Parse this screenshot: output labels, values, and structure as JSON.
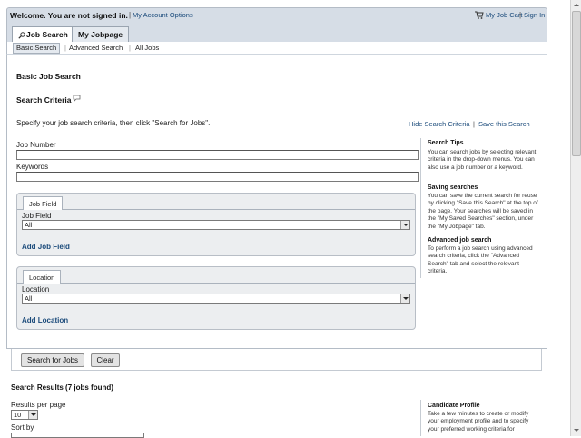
{
  "header": {
    "welcome": "Welcome. You are not signed in.",
    "separator": "|",
    "my_account": "My Account Options",
    "cart": "My Job Cart",
    "sign_in": "Sign In"
  },
  "tabs": {
    "job_search": "Job Search",
    "my_jobpage": "My Jobpage"
  },
  "subtabs": {
    "basic": "Basic Search",
    "advanced": "Advanced Search",
    "all_jobs": "All Jobs",
    "sep": "|"
  },
  "main": {
    "heading": "Basic Job Search",
    "criteria_heading": "Search Criteria",
    "instruction": "Specify your job search criteria, then click \"Search for Jobs\".",
    "hide_criteria": "Hide Search Criteria",
    "link_sep": "|",
    "save_search": "Save this Search",
    "job_number_label": "Job Number",
    "job_number_value": "",
    "keywords_label": "Keywords",
    "keywords_value": ""
  },
  "job_field": {
    "tab": "Job Field",
    "label": "Job Field",
    "selected": "All",
    "add": "Add Job Field"
  },
  "location": {
    "tab": "Location",
    "label": "Location",
    "selected": "All",
    "add": "Add Location"
  },
  "tips": {
    "search_title": "Search Tips",
    "search_body": "You can search jobs by selecting relevant criteria in the drop-down menus. You can also use a job number or a keyword.",
    "saving_title": "Saving searches",
    "saving_body": "You can save the current search for reuse by clicking \"Save this Search\" at the top of the page. Your searches will be saved in the \"My Saved Searches\" section, under the \"My Jobpage\" tab.",
    "advanced_title": "Advanced job search",
    "advanced_body": "To perform a job search using advanced search criteria, click the \"Advanced Search\" tab and select the relevant criteria."
  },
  "buttons": {
    "search": "Search for Jobs",
    "clear": "Clear"
  },
  "results": {
    "heading": "Search Results (7 jobs found)",
    "per_page_label": "Results per page",
    "per_page_value": "10",
    "sort_label": "Sort by"
  },
  "profile": {
    "title": "Candidate Profile",
    "body": "Take a few minutes to create or modify your employment profile and to specify your preferred working criteria for"
  }
}
